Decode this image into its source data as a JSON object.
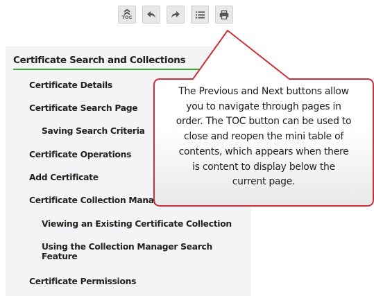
{
  "toolbar": {
    "toc_label": "TOC",
    "buttons": [
      {
        "name": "toc",
        "icon": "toc-chevrons-icon"
      },
      {
        "name": "previous",
        "icon": "arrow-left-icon"
      },
      {
        "name": "next",
        "icon": "arrow-right-icon"
      },
      {
        "name": "list",
        "icon": "list-icon"
      },
      {
        "name": "print",
        "icon": "printer-icon"
      }
    ]
  },
  "toc": {
    "heading": "Certificate Search and Collections",
    "items": [
      {
        "label": "Certificate Details",
        "level": 1
      },
      {
        "label": "Certificate Search Page",
        "level": 1
      },
      {
        "label": "Saving Search Criteria",
        "level": 2
      },
      {
        "label": "Certificate Operations",
        "level": 1
      },
      {
        "label": "Add Certificate",
        "level": 1
      },
      {
        "label": "Certificate Collection Manager",
        "level": 1
      },
      {
        "label": "Viewing an Existing Certificate Collection",
        "level": 2
      },
      {
        "label": "Using the Collection Manager Search",
        "level": 2
      },
      {
        "label": "Feature",
        "level": 2
      },
      {
        "label": "Certificate Permissions",
        "level": 1
      }
    ]
  },
  "callout": {
    "lines": [
      "The Previous and Next buttons allow",
      "you to navigate through pages in",
      "order. The TOC button can be used to",
      "close and reopen the mini table of",
      "contents, which appears when there",
      "is content to display below the",
      "current page."
    ],
    "border_color": "#c8313a",
    "accent_color": "#3aaa35"
  }
}
